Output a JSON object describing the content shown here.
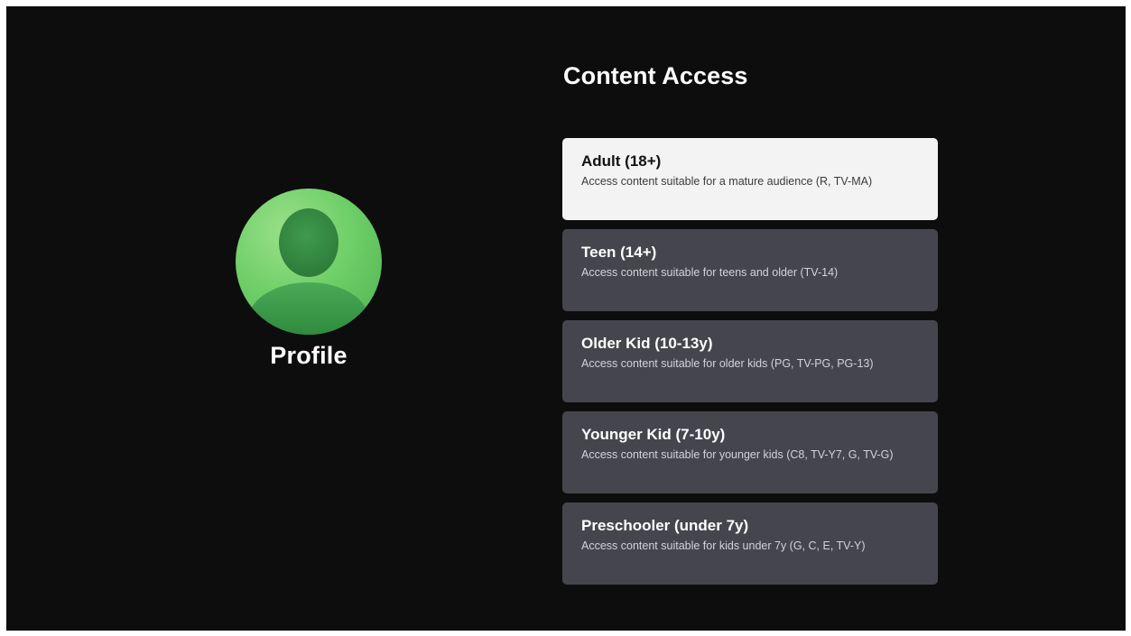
{
  "profile": {
    "name": "Profile"
  },
  "content_access": {
    "title": "Content Access",
    "selected_index": 0,
    "options": [
      {
        "title": "Adult (18+)",
        "description": "Access content suitable for a mature audience (R, TV-MA)"
      },
      {
        "title": "Teen (14+)",
        "description": "Access content suitable for teens and older (TV-14)"
      },
      {
        "title": "Older Kid (10-13y)",
        "description": "Access content suitable for older kids (PG, TV-PG, PG-13)"
      },
      {
        "title": "Younger Kid (7-10y)",
        "description": "Access content suitable for younger kids (C8, TV-Y7, G, TV-G)"
      },
      {
        "title": "Preschooler (under 7y)",
        "description": "Access content suitable for kids under 7y (G, C, E, TV-Y)"
      }
    ]
  },
  "colors": {
    "background": "#0d0d0e",
    "card": "#45464d",
    "card_selected": "#f3f3f3",
    "avatar_green": "#6fcf68"
  }
}
